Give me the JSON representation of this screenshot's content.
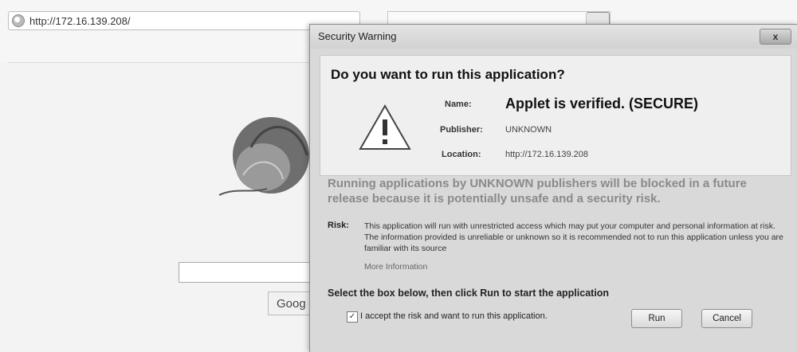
{
  "browser": {
    "url": "http://172.16.139.208/"
  },
  "page": {
    "search_button_label": "Goog"
  },
  "dialog": {
    "title": "Security Warning",
    "close_label": "x",
    "question": "Do you want to run this application?",
    "name_label": "Name:",
    "name_value": "Applet is verified. (SECURE)",
    "publisher_label": "Publisher:",
    "publisher_value": "UNKNOWN",
    "location_label": "Location:",
    "location_value": "http://172.16.139.208",
    "notice": "Running applications by UNKNOWN publishers will be blocked in a future release because it is potentially unsafe and a security risk.",
    "risk_label": "Risk:",
    "risk_text": "This application will run with unrestricted access which may put your computer and personal information at risk. The information provided is unreliable or unknown so it is recommended not to run this application unless you are familiar with its source",
    "more_info": "More Information",
    "select_text": "Select the box below, then click Run to start the application",
    "accept_text": "I accept the risk and want to run this application.",
    "checkbox_checked": true,
    "run_label": "Run",
    "cancel_label": "Cancel"
  },
  "icons": [
    "globe-icon",
    "warning-icon",
    "close-icon",
    "checkbox-check-icon"
  ]
}
